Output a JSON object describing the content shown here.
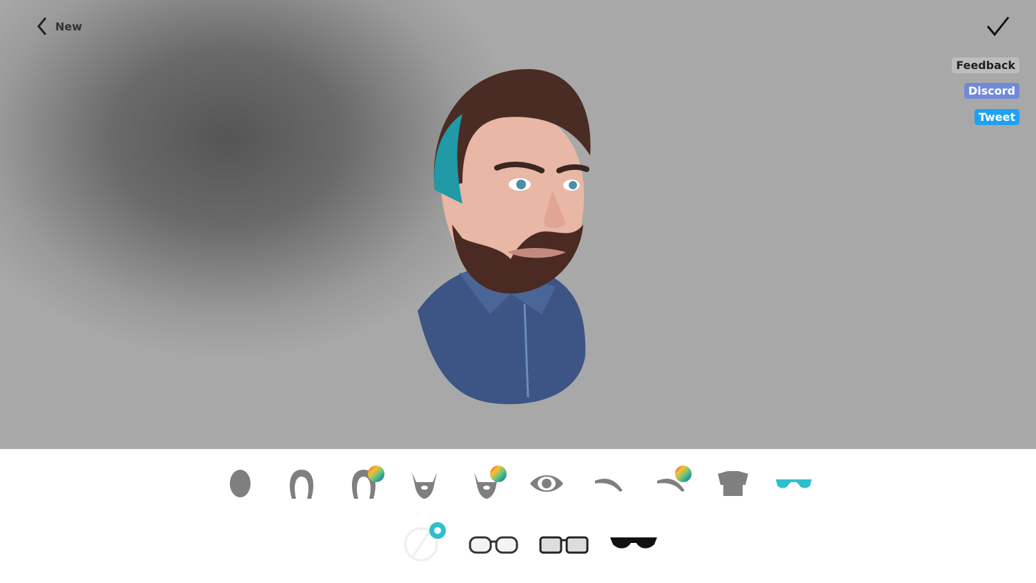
{
  "header": {
    "back_label": "New",
    "back_icon": "chevron-left-icon",
    "confirm_icon": "checkmark-icon"
  },
  "links": {
    "feedback": "Feedback",
    "discord": "Discord",
    "tweet": "Tweet"
  },
  "colors": {
    "accent": "#2ebfcc",
    "discord": "#7289da",
    "tweet": "#1da1f2",
    "icon_gray": "#7f7f7f"
  },
  "categories": [
    {
      "name": "head-shape",
      "icon": "head-icon"
    },
    {
      "name": "hair",
      "icon": "hair-icon"
    },
    {
      "name": "hair-color",
      "icon": "hair-color-icon"
    },
    {
      "name": "beard",
      "icon": "beard-icon"
    },
    {
      "name": "beard-color",
      "icon": "beard-color-icon"
    },
    {
      "name": "eyes",
      "icon": "eye-icon"
    },
    {
      "name": "eyebrows",
      "icon": "eyebrow-icon"
    },
    {
      "name": "eyebrow-color",
      "icon": "eyebrow-color-icon"
    },
    {
      "name": "shirt",
      "icon": "shirt-icon"
    },
    {
      "name": "glasses",
      "icon": "glasses-icon",
      "selected": true
    }
  ],
  "glasses_options": [
    {
      "name": "none",
      "selected": true
    },
    {
      "name": "round-frames"
    },
    {
      "name": "square-frames"
    },
    {
      "name": "sunglasses"
    }
  ]
}
